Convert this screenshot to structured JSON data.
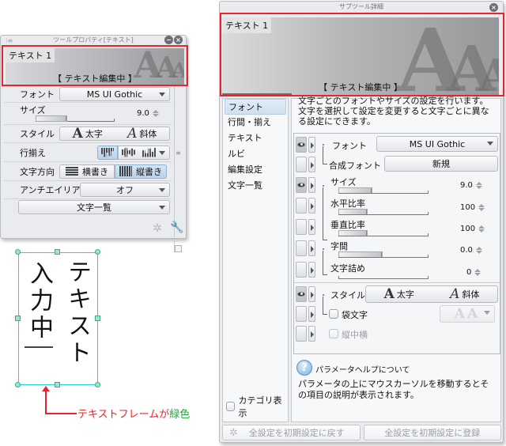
{
  "tool_property": {
    "title": "ツールプロパティ[テキスト]",
    "preview_label": "テキスト 1",
    "preview_status": "【 テキスト編集中 】",
    "rows": {
      "font": {
        "label": "フォント",
        "value": "MS UI Gothic"
      },
      "size": {
        "label": "サイズ",
        "value": "9.0",
        "fill": 0.38
      },
      "style": {
        "label": "スタイル",
        "bold": "太字",
        "italic": "斜体"
      },
      "align": {
        "label": "行揃え",
        "options": [
          "top-align",
          "center-align",
          "bottom-align"
        ],
        "selected": "top-align"
      },
      "direction": {
        "label": "文字方向",
        "horizontal": "横書き",
        "vertical": "縦書き",
        "selected": "vertical"
      },
      "antialias": {
        "label": "アンチエイリアス",
        "value": "オフ"
      },
      "charlist": {
        "label": "文字一覧"
      }
    }
  },
  "canvas": {
    "text_line_1": "テキスト",
    "text_line_2": "入力中",
    "annotation_prefix": "テキストフレームが",
    "annotation_highlight": "緑色",
    "frame_color": "#27d2d6"
  },
  "sub_tool_detail": {
    "title": "サブツール詳細",
    "preview_label": "テキスト 1",
    "preview_status": "【 テキスト編集中 】",
    "categories": [
      {
        "label": "フォント",
        "selected": true
      },
      {
        "label": "行間・揃え",
        "selected": false
      },
      {
        "label": "テキスト",
        "selected": false
      },
      {
        "label": "ルビ",
        "selected": false
      },
      {
        "label": "編集設定",
        "selected": false
      },
      {
        "label": "文字一覧",
        "selected": false
      }
    ],
    "category_display_label": "カテゴリ表示",
    "description": "文字ごとのフォントやサイズの設定を行います。\n文字を選択して設定を変更すると文字ごとに異なる設定にできます。",
    "params": {
      "font": {
        "label": "フォント",
        "value": "MS UI Gothic"
      },
      "composite_font": {
        "label": "合成フォント",
        "button": "新規"
      },
      "size": {
        "label": "サイズ",
        "value": "9.0",
        "fill": 0.38
      },
      "h_ratio": {
        "label": "水平比率",
        "value": "100",
        "fill": 0.32
      },
      "v_ratio": {
        "label": "垂直比率",
        "value": "100",
        "fill": 0.32
      },
      "spacing": {
        "label": "字間",
        "value": "0.0",
        "fill": 0.5
      },
      "tracking": {
        "label": "文字詰め",
        "value": "0",
        "fill": 0.0
      },
      "style": {
        "label": "スタイル",
        "bold": "太字",
        "italic": "斜体"
      },
      "outline": {
        "label": "袋文字"
      },
      "tate_chu_yoko": {
        "label": "縦中横"
      }
    },
    "help": {
      "title": "パラメータヘルプについて",
      "body": "パラメータの上にマウスカーソルを移動するとその項目の説明が表示されます。"
    },
    "footer": {
      "reset_label": "全設定を初期設定に戻す",
      "register_label": "全設定を初期設定に登録"
    }
  },
  "colors": {
    "highlight_frame": "#e8252b",
    "annotation_red": "#e8252b",
    "annotation_green": "#25a336"
  }
}
